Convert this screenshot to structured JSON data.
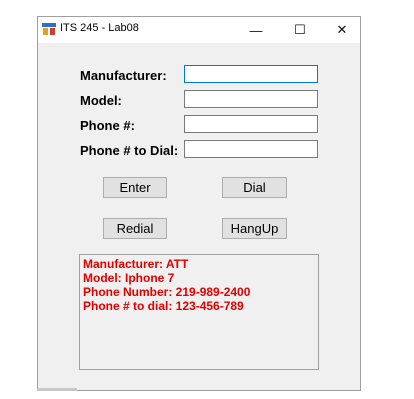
{
  "window": {
    "title": "ITS 245 - Lab08",
    "controls": {
      "minimize": "—",
      "maximize": "☐",
      "close": "✕"
    }
  },
  "form": {
    "manufacturer_label": "Manufacturer:",
    "model_label": "Model:",
    "phone_label": "Phone #:",
    "dial_label": "Phone # to Dial:",
    "manufacturer_value": "",
    "model_value": "",
    "phone_value": "",
    "dial_value": ""
  },
  "buttons": {
    "enter": "Enter",
    "dial": "Dial",
    "redial": "Redial",
    "hangup": "HangUp"
  },
  "output": {
    "lines": [
      "Manufacturer: ATT",
      "Model: Iphone 7",
      "Phone Number: 219-989-2400",
      "Phone # to dial: 123-456-789"
    ],
    "text_color": "#e00000"
  }
}
